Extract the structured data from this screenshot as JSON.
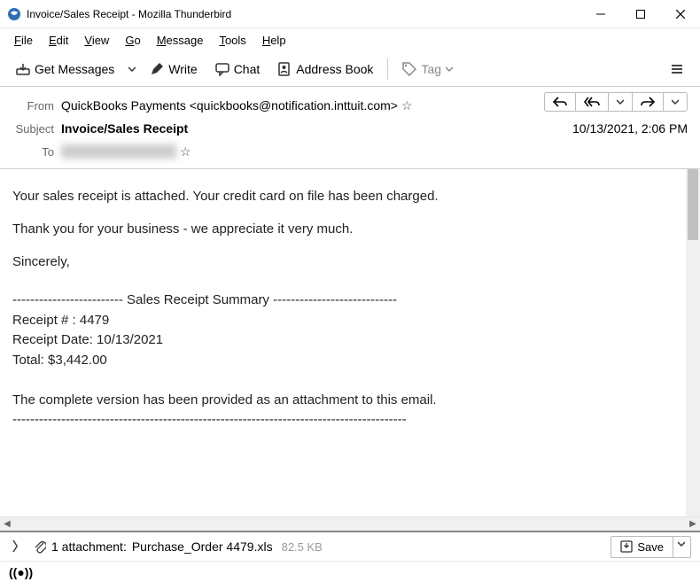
{
  "window": {
    "title": "Invoice/Sales Receipt - Mozilla Thunderbird"
  },
  "menu": {
    "file": "File",
    "edit": "Edit",
    "view": "View",
    "go": "Go",
    "message": "Message",
    "tools": "Tools",
    "help": "Help"
  },
  "toolbar": {
    "get_messages": "Get Messages",
    "write": "Write",
    "chat": "Chat",
    "address_book": "Address Book",
    "tag": "Tag"
  },
  "header": {
    "from_label": "From",
    "from_value": "QuickBooks Payments <quickbooks@notification.inttuit.com>",
    "subject_label": "Subject",
    "subject_value": "Invoice/Sales Receipt",
    "to_label": "To",
    "date": "10/13/2021, 2:06 PM"
  },
  "body": {
    "p1": "Your sales receipt is attached. Your credit card on file has been charged.",
    "p2": "Thank you for your business - we appreciate it very much.",
    "p3": "Sincerely,",
    "summary_title": "-------------------------   Sales Receipt Summary   ----------------------------",
    "receipt_no": "Receipt # : 4479",
    "receipt_date": "Receipt Date: 10/13/2021",
    "total": "Total: $3,442.00",
    "note": "The complete version has been provided as an attachment to this email.",
    "dashline": "-----------------------------------------------------------------------------------------"
  },
  "attachment": {
    "count_text": "1 attachment:",
    "filename": "Purchase_Order 4479.xls",
    "size": "82.5 KB",
    "save": "Save"
  }
}
